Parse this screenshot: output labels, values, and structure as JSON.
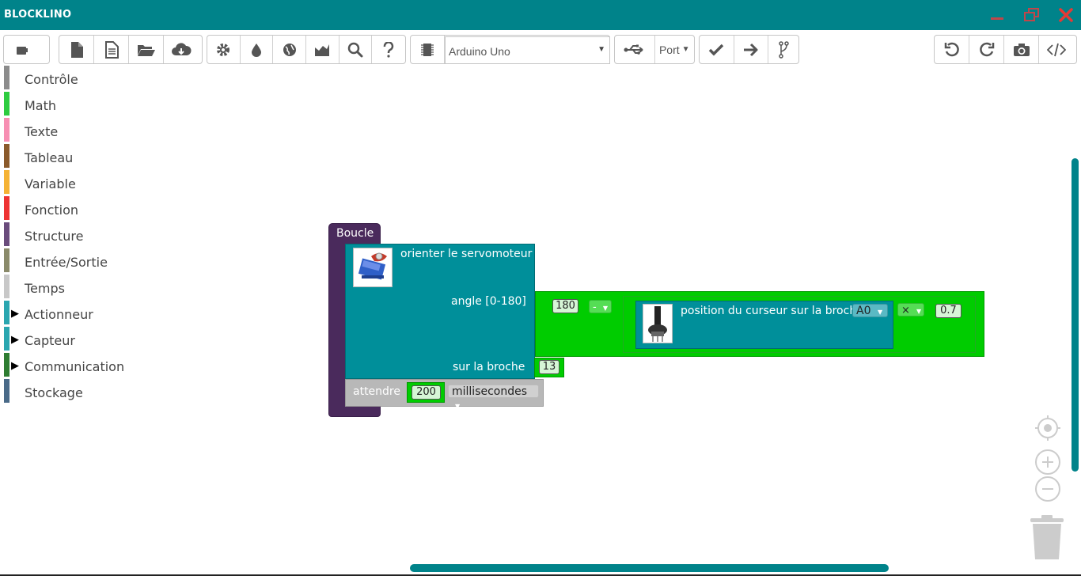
{
  "app": {
    "title": "BLOCKLINO"
  },
  "colors": {
    "accent": "#00838a",
    "close": "#e53935",
    "loop": "#4a2a5c",
    "servo": "#008f9a",
    "math": "#00cc00",
    "wait": "#b8b8b8"
  },
  "toolbar": {
    "board_value": "Arduino Uno",
    "port_value": "Port",
    "icons": [
      "puzzle-icon",
      "new-file-icon",
      "file-text-icon",
      "folder-open-icon",
      "cloud-download-icon",
      "gear-icon",
      "tint-icon",
      "globe-icon",
      "chart-icon",
      "search-icon",
      "help-icon",
      "chip-icon",
      "usb-icon",
      "check-icon",
      "arrow-right-icon",
      "branch-icon",
      "undo-icon",
      "redo-icon",
      "camera-icon",
      "code-icon"
    ]
  },
  "toolbox": {
    "items": [
      {
        "label": "Contrôle",
        "color": "#8c8c8c",
        "expandable": false
      },
      {
        "label": "Math",
        "color": "#2ecc40",
        "expandable": false
      },
      {
        "label": "Texte",
        "color": "#f78fb3",
        "expandable": false
      },
      {
        "label": "Tableau",
        "color": "#8b5a2b",
        "expandable": false
      },
      {
        "label": "Variable",
        "color": "#f5b335",
        "expandable": false
      },
      {
        "label": "Fonction",
        "color": "#ee3333",
        "expandable": false
      },
      {
        "label": "Structure",
        "color": "#6a4c7c",
        "expandable": false
      },
      {
        "label": "Entrée/Sortie",
        "color": "#8a8a6a",
        "expandable": false
      },
      {
        "label": "Temps",
        "color": "#c8c8c8",
        "expandable": false
      },
      {
        "label": "Actionneur",
        "color": "#2aa6b0",
        "expandable": true
      },
      {
        "label": "Capteur",
        "color": "#2aa6b0",
        "expandable": true
      },
      {
        "label": "Communication",
        "color": "#2e7d32",
        "expandable": true
      },
      {
        "label": "Stockage",
        "color": "#4a6a88",
        "expandable": false
      }
    ]
  },
  "workspace": {
    "loop_label": "Boucle",
    "servo": {
      "title": "orienter le servomoteur",
      "angle_label": "angle [0-180]",
      "pin_label": "sur la broche",
      "pin_value": "13"
    },
    "math_expr": {
      "left_value": "180",
      "operator": "-",
      "pot_label": "position du curseur sur la broche",
      "pot_pin": "A0",
      "mult_operator": "×",
      "factor": "0.7"
    },
    "wait": {
      "label": "attendre",
      "value": "200",
      "unit": "millisecondes"
    }
  }
}
